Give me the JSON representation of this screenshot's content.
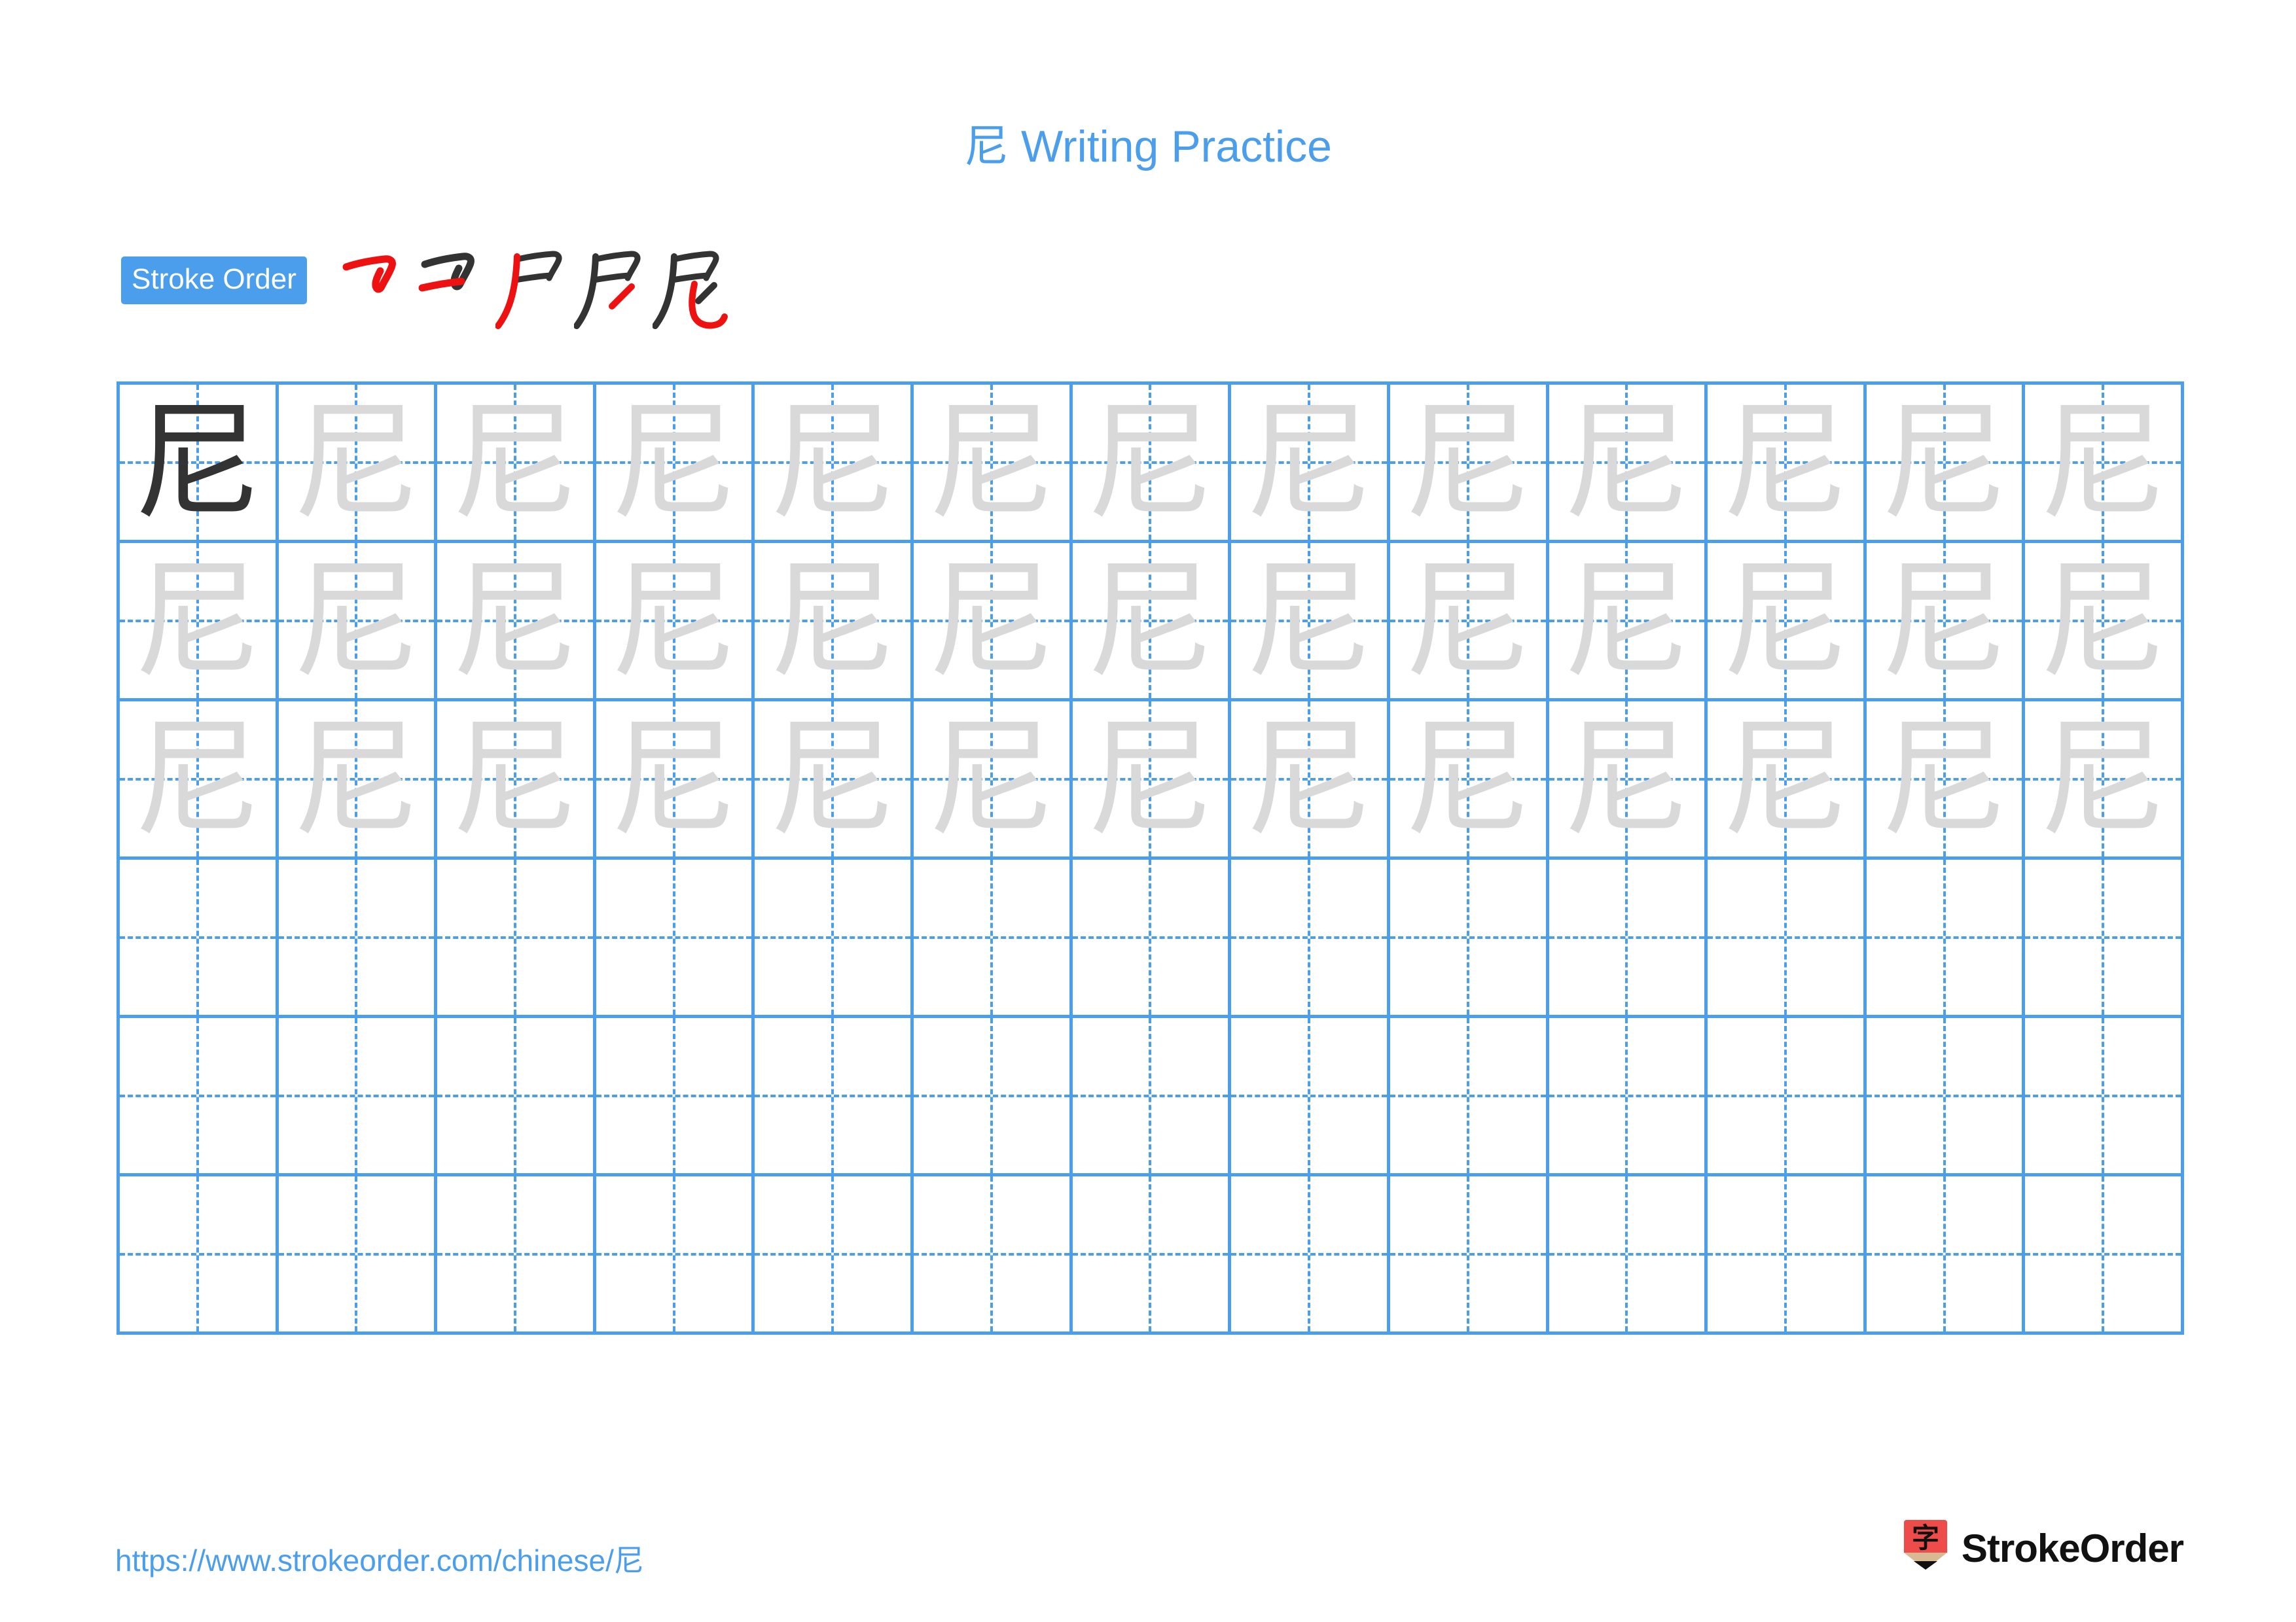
{
  "character": "尼",
  "title": {
    "character": "尼",
    "text": " Writing Practice",
    "full": "尼 Writing Practice",
    "color": "#4a9eec"
  },
  "stroke_order": {
    "badge_label": "Stroke Order",
    "badge_bg": "#4a9eec",
    "badge_text_color": "#ffffff",
    "new_stroke_color": "#ee1111",
    "prev_stroke_color": "#333333",
    "stroke_count": 5,
    "steps": [
      {
        "index": 1,
        "new_stroke": "horizontal-bend-hook"
      },
      {
        "index": 2,
        "new_stroke": "horizontal"
      },
      {
        "index": 3,
        "new_stroke": "left-falling-stroke"
      },
      {
        "index": 4,
        "new_stroke": "short-left-falling"
      },
      {
        "index": 5,
        "new_stroke": "bend-with-upward-hook"
      }
    ]
  },
  "grid": {
    "columns": 13,
    "rows": 6,
    "line_color": "#4a9eec",
    "guide_color": "#4a9eec",
    "model_char_color": "#333333",
    "trace_char_color": "#d9d9d9",
    "cells": [
      [
        "model",
        "trace",
        "trace",
        "trace",
        "trace",
        "trace",
        "trace",
        "trace",
        "trace",
        "trace",
        "trace",
        "trace",
        "trace"
      ],
      [
        "trace",
        "trace",
        "trace",
        "trace",
        "trace",
        "trace",
        "trace",
        "trace",
        "trace",
        "trace",
        "trace",
        "trace",
        "trace"
      ],
      [
        "trace",
        "trace",
        "trace",
        "trace",
        "trace",
        "trace",
        "trace",
        "trace",
        "trace",
        "trace",
        "trace",
        "trace",
        "trace"
      ],
      [
        "empty",
        "empty",
        "empty",
        "empty",
        "empty",
        "empty",
        "empty",
        "empty",
        "empty",
        "empty",
        "empty",
        "empty",
        "empty"
      ],
      [
        "empty",
        "empty",
        "empty",
        "empty",
        "empty",
        "empty",
        "empty",
        "empty",
        "empty",
        "empty",
        "empty",
        "empty",
        "empty"
      ],
      [
        "empty",
        "empty",
        "empty",
        "empty",
        "empty",
        "empty",
        "empty",
        "empty",
        "empty",
        "empty",
        "empty",
        "empty",
        "empty"
      ]
    ]
  },
  "footer": {
    "url": "https://www.strokeorder.com/chinese/尼",
    "url_color": "#4a9eec",
    "brand_name": "StrokeOrder",
    "brand_icon_char": "字",
    "brand_icon_color": "#ee4b4b",
    "brand_icon_wood_color": "#d9b894",
    "brand_icon_tip_color": "#111111"
  }
}
